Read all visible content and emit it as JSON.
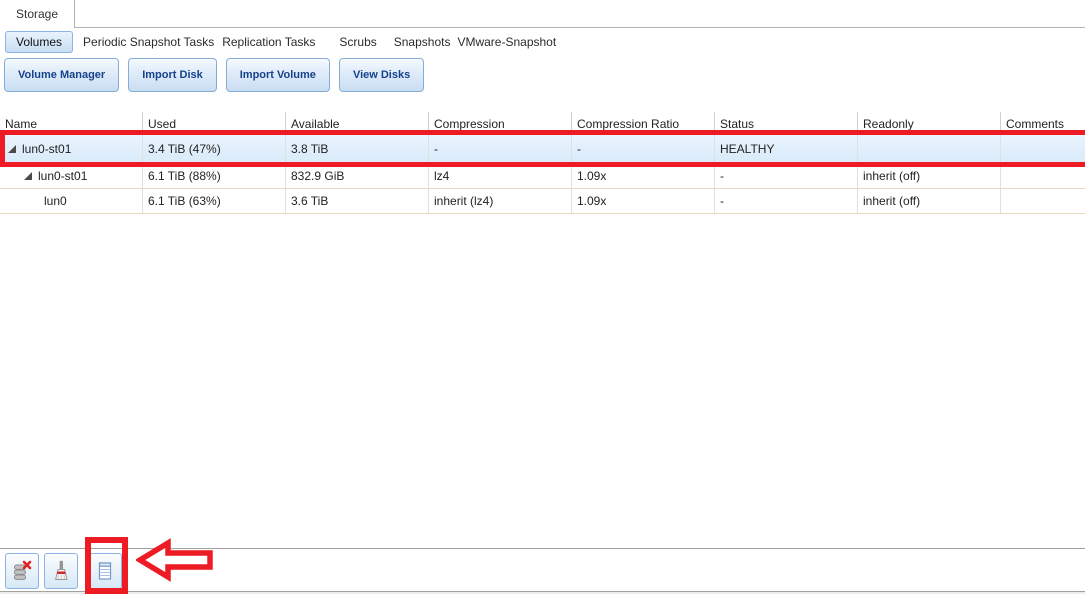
{
  "window": {
    "tab_label": "Storage"
  },
  "subtabs": [
    {
      "label": "Volumes",
      "active": true
    },
    {
      "label": "Periodic Snapshot Tasks",
      "active": false
    },
    {
      "label": "Replication Tasks",
      "active": false
    },
    {
      "label": "Scrubs",
      "active": false
    },
    {
      "label": "Snapshots",
      "active": false
    },
    {
      "label": "VMware-Snapshot",
      "active": false
    }
  ],
  "action_buttons": [
    {
      "label": "Volume Manager"
    },
    {
      "label": "Import Disk"
    },
    {
      "label": "Import Volume"
    },
    {
      "label": "View Disks"
    }
  ],
  "table": {
    "columns": [
      "Name",
      "Used",
      "Available",
      "Compression",
      "Compression Ratio",
      "Status",
      "Readonly",
      "Comments"
    ],
    "rows": [
      {
        "name": "lun0-st01",
        "used": "3.4 TiB (47%)",
        "available": "3.8 TiB",
        "compression": "-",
        "compression_ratio": "-",
        "status": "HEALTHY",
        "readonly": "",
        "comments": "",
        "selected": true,
        "expanded": true,
        "indent": 0
      },
      {
        "name": "lun0-st01",
        "used": "6.1 TiB (88%)",
        "available": "832.9 GiB",
        "compression": "lz4",
        "compression_ratio": "1.09x",
        "status": "-",
        "readonly": "inherit (off)",
        "comments": "",
        "selected": false,
        "expanded": true,
        "indent": 1
      },
      {
        "name": "lun0",
        "used": "6.1 TiB (63%)",
        "available": "3.6 TiB",
        "compression": "inherit (lz4)",
        "compression_ratio": "1.09x",
        "status": "-",
        "readonly": "inherit (off)",
        "comments": "",
        "selected": false,
        "expanded": false,
        "indent": 2
      }
    ]
  },
  "bottom_toolbar": {
    "icons": [
      "database-delete-icon",
      "broom-icon",
      "status-sheet-icon"
    ]
  },
  "annotations": {
    "color": "#ed1c24",
    "shapes": [
      "box-around-selected-row",
      "box-around-status-button",
      "arrow-pointing-at-status-button"
    ]
  }
}
